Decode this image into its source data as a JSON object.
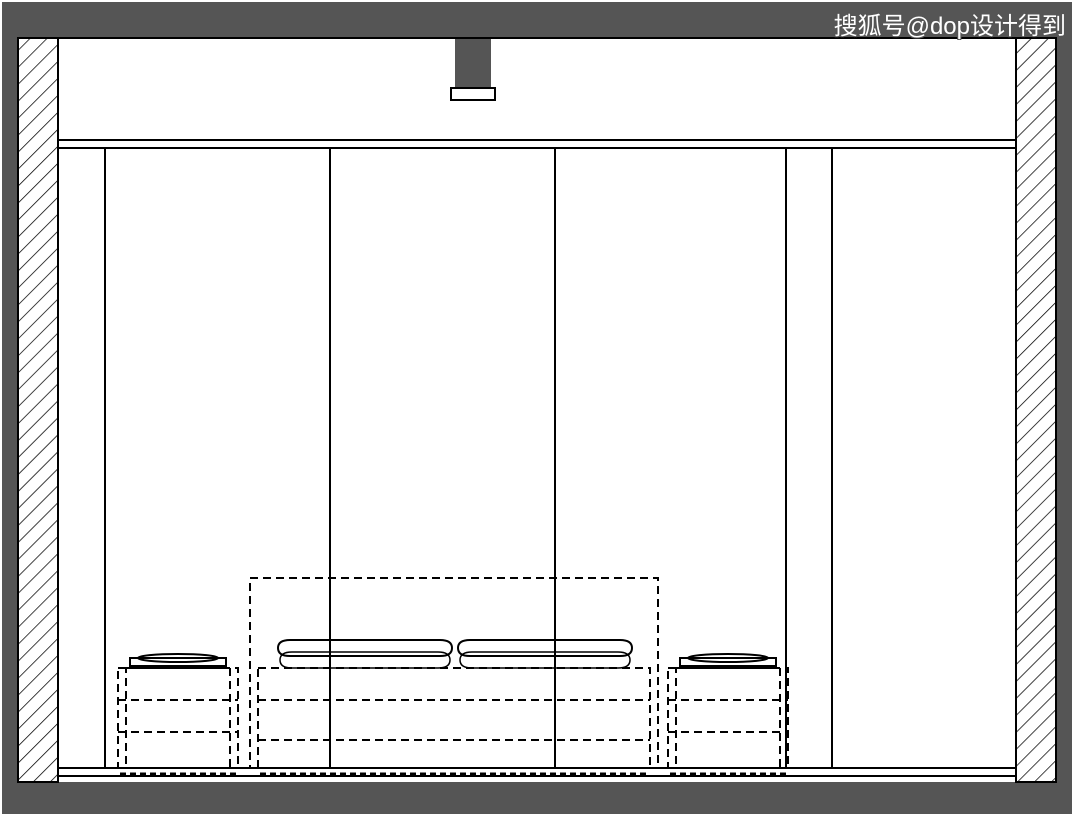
{
  "watermark": "搜狐号@dop设计得到",
  "drawing": {
    "type": "interior-elevation",
    "subject": "bedroom-wall",
    "elements": [
      "wall-section",
      "ceiling-beam",
      "wall-panels",
      "bed",
      "nightstands"
    ]
  }
}
